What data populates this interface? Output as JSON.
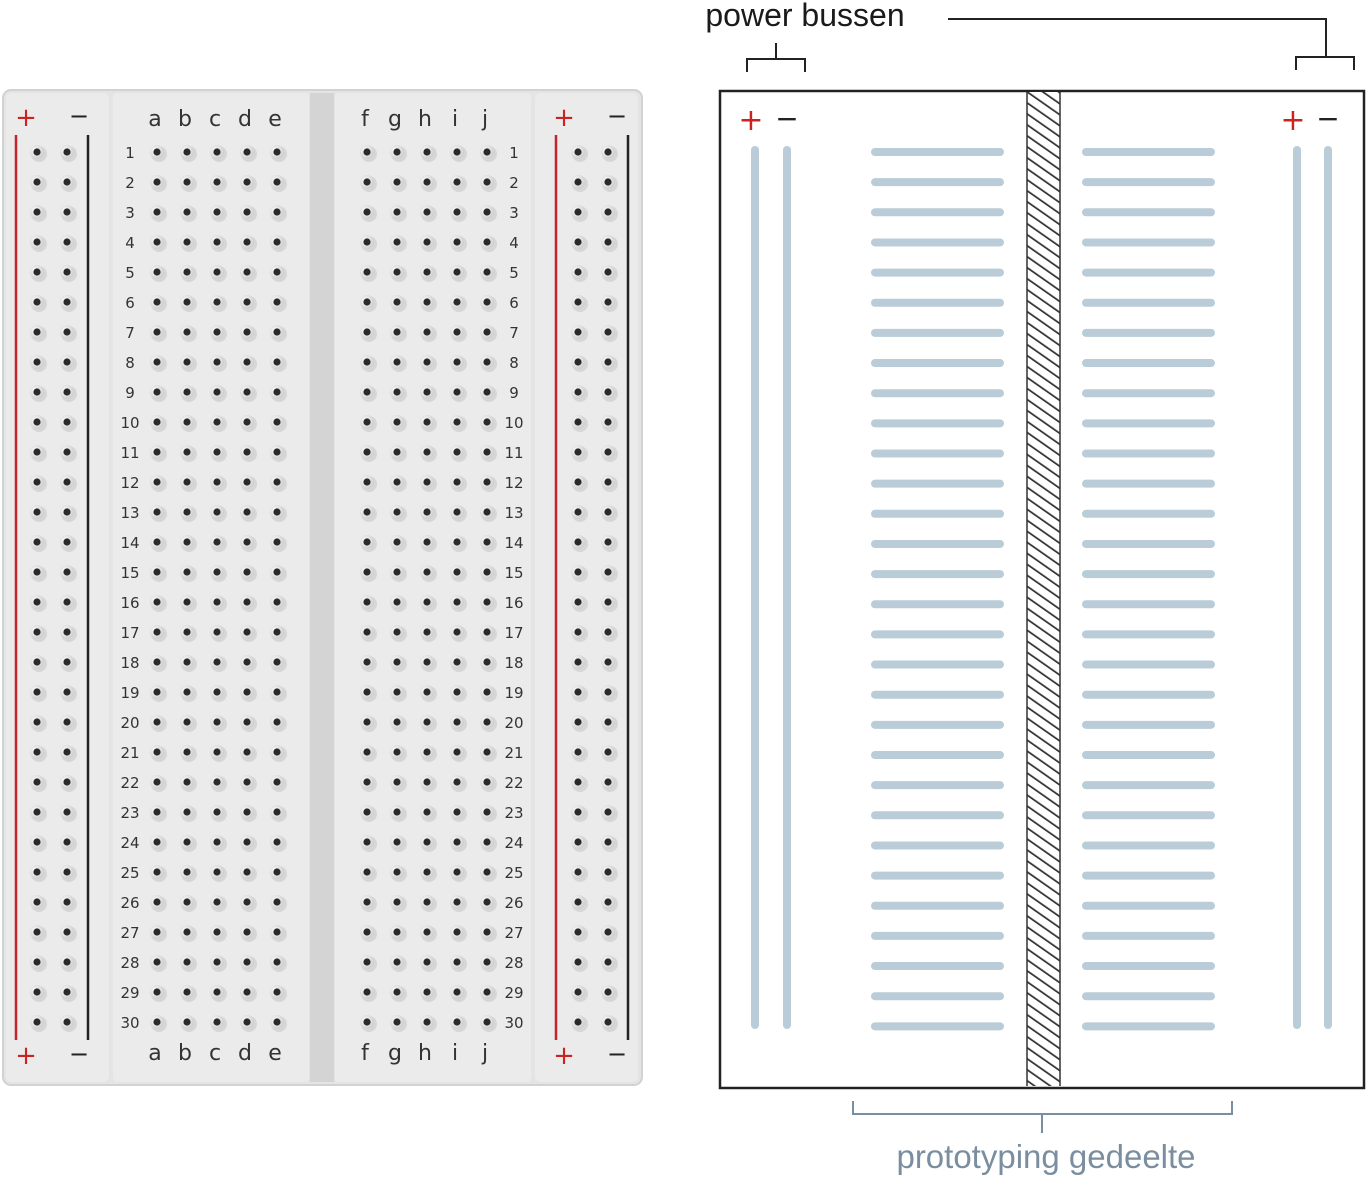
{
  "breadboard": {
    "rows": 30,
    "row_labels": [
      "1",
      "2",
      "3",
      "4",
      "5",
      "6",
      "7",
      "8",
      "9",
      "10",
      "11",
      "12",
      "13",
      "14",
      "15",
      "16",
      "17",
      "18",
      "19",
      "20",
      "21",
      "22",
      "23",
      "24",
      "25",
      "26",
      "27",
      "28",
      "29",
      "30"
    ],
    "left_columns": [
      "a",
      "b",
      "c",
      "d",
      "e"
    ],
    "right_columns": [
      "f",
      "g",
      "h",
      "i",
      "j"
    ],
    "plus_symbol": "+",
    "minus_symbol": "−"
  },
  "schematic": {
    "strip_rows": 30,
    "plus_symbol": "+",
    "minus_symbol": "−",
    "power_bus_label": "power bussen",
    "prototyping_label": "prototyping gedeelte"
  },
  "colors": {
    "plus_red": "#cc2222",
    "minus_black": "#222222",
    "strip_blue": "#b9ccd8",
    "board_bg": "#e6e6e6",
    "prototyping_label_color": "#7a8ea0"
  }
}
